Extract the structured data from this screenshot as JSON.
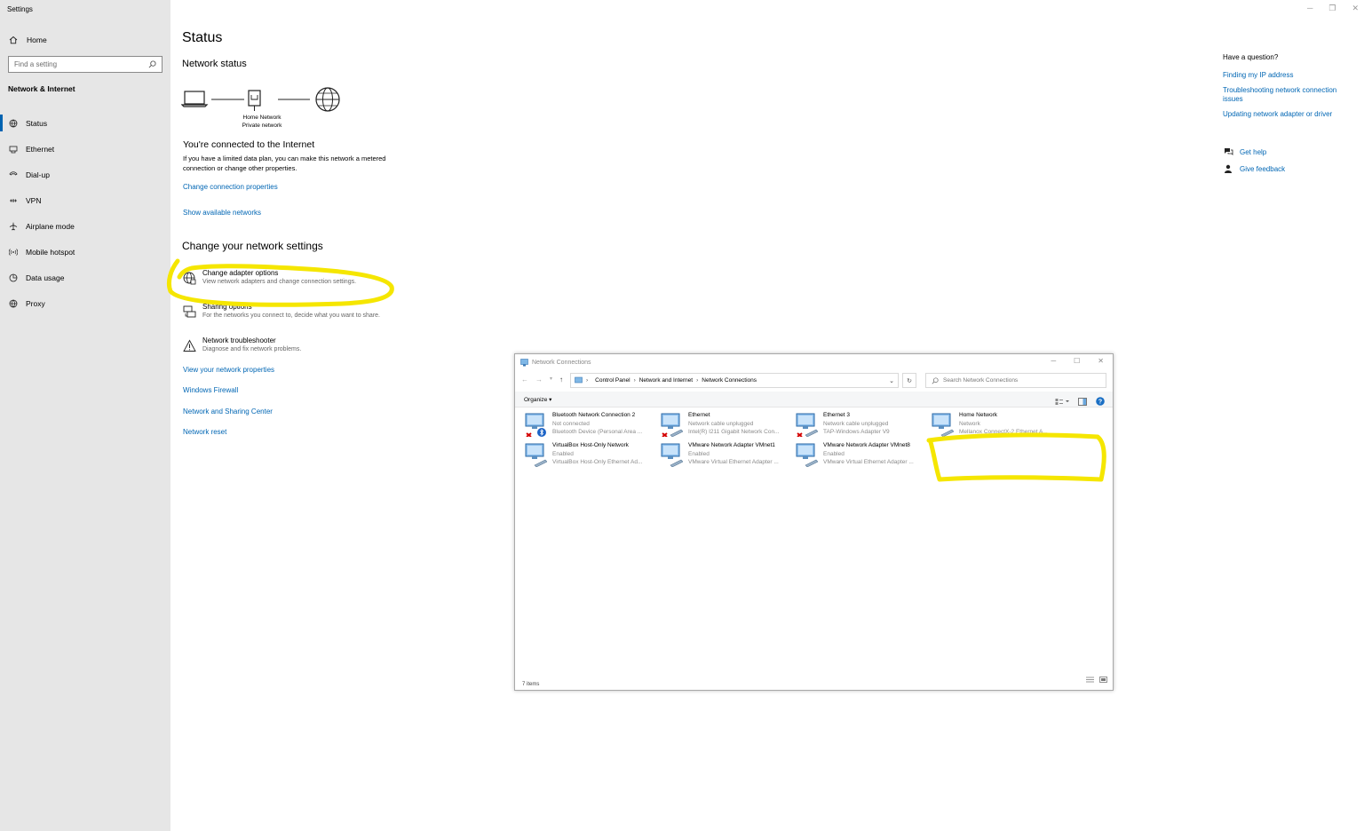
{
  "app": {
    "title": "Settings"
  },
  "window_controls": [
    "─",
    "❐",
    "✕"
  ],
  "sidebar": {
    "home_label": "Home",
    "search_placeholder": "Find a setting",
    "section_title": "Network & Internet",
    "items": [
      {
        "label": "Status",
        "icon": "status-globe-icon",
        "active": true
      },
      {
        "label": "Ethernet",
        "icon": "ethernet-icon"
      },
      {
        "label": "Dial-up",
        "icon": "dialup-icon"
      },
      {
        "label": "VPN",
        "icon": "vpn-icon"
      },
      {
        "label": "Airplane mode",
        "icon": "airplane-icon"
      },
      {
        "label": "Mobile hotspot",
        "icon": "hotspot-icon"
      },
      {
        "label": "Data usage",
        "icon": "data-usage-icon"
      },
      {
        "label": "Proxy",
        "icon": "proxy-globe-icon"
      }
    ]
  },
  "main": {
    "title": "Status",
    "network_status_heading": "Network status",
    "network_name": "Home Network",
    "network_type": "Private network",
    "connected_heading": "You're connected to the Internet",
    "connected_desc": "If you have a limited data plan, you can make this network a metered connection or change other properties.",
    "link_change_props": "Change connection properties",
    "link_show_networks": "Show available networks",
    "change_heading": "Change your network settings",
    "options": [
      {
        "title": "Change adapter options",
        "subtitle": "View network adapters and change connection settings.",
        "icon": "adapter-globe-icon"
      },
      {
        "title": "Sharing options",
        "subtitle": "For the networks you connect to, decide what you want to share.",
        "icon": "sharing-icon"
      },
      {
        "title": "Network troubleshooter",
        "subtitle": "Diagnose and fix network problems.",
        "icon": "warning-icon"
      }
    ],
    "links": [
      "View your network properties",
      "Windows Firewall",
      "Network and Sharing Center",
      "Network reset"
    ]
  },
  "help": {
    "question": "Have a question?",
    "links": [
      "Finding my IP address",
      "Troubleshooting network connection issues",
      "Updating network adapter or driver"
    ],
    "get_help": "Get help",
    "give_feedback": "Give feedback"
  },
  "network_connections": {
    "title": "Network Connections",
    "win_buttons": [
      "─",
      "☐",
      "✕"
    ],
    "breadcrumb": [
      "Control Panel",
      "Network and Internet",
      "Network Connections"
    ],
    "search_placeholder": "Search Network Connections",
    "organize_label": "Organize ▾",
    "status_text": "7 items",
    "adapters": [
      {
        "name": "Bluetooth Network Connection 2",
        "status": "Not connected",
        "device": "Bluetooth Device (Personal Area ...",
        "state": "disconnected",
        "bluetooth": true
      },
      {
        "name": "Ethernet",
        "status": "Network cable unplugged",
        "device": "Intel(R) I211 Gigabit Network Con...",
        "state": "disconnected"
      },
      {
        "name": "Ethernet 3",
        "status": "Network cable unplugged",
        "device": "TAP-Windows Adapter V9",
        "state": "disconnected"
      },
      {
        "name": "Home Network",
        "status": "Network",
        "device": "Mellanox ConnectX-2 Ethernet A...",
        "state": "connected"
      },
      {
        "name": "VirtualBox Host-Only Network",
        "status": "Enabled",
        "device": "VirtualBox Host-Only Ethernet Ad...",
        "state": "enabled"
      },
      {
        "name": "VMware Network Adapter VMnet1",
        "status": "Enabled",
        "device": "VMware Virtual Ethernet Adapter ...",
        "state": "enabled"
      },
      {
        "name": "VMware Network Adapter VMnet8",
        "status": "Enabled",
        "device": "VMware Virtual Ethernet Adapter ...",
        "state": "enabled"
      }
    ]
  },
  "colors": {
    "accent": "#0063b1",
    "link": "#0066b4",
    "sidebar_bg": "#e6e6e6",
    "highlight_annotation": "#f5e600"
  }
}
